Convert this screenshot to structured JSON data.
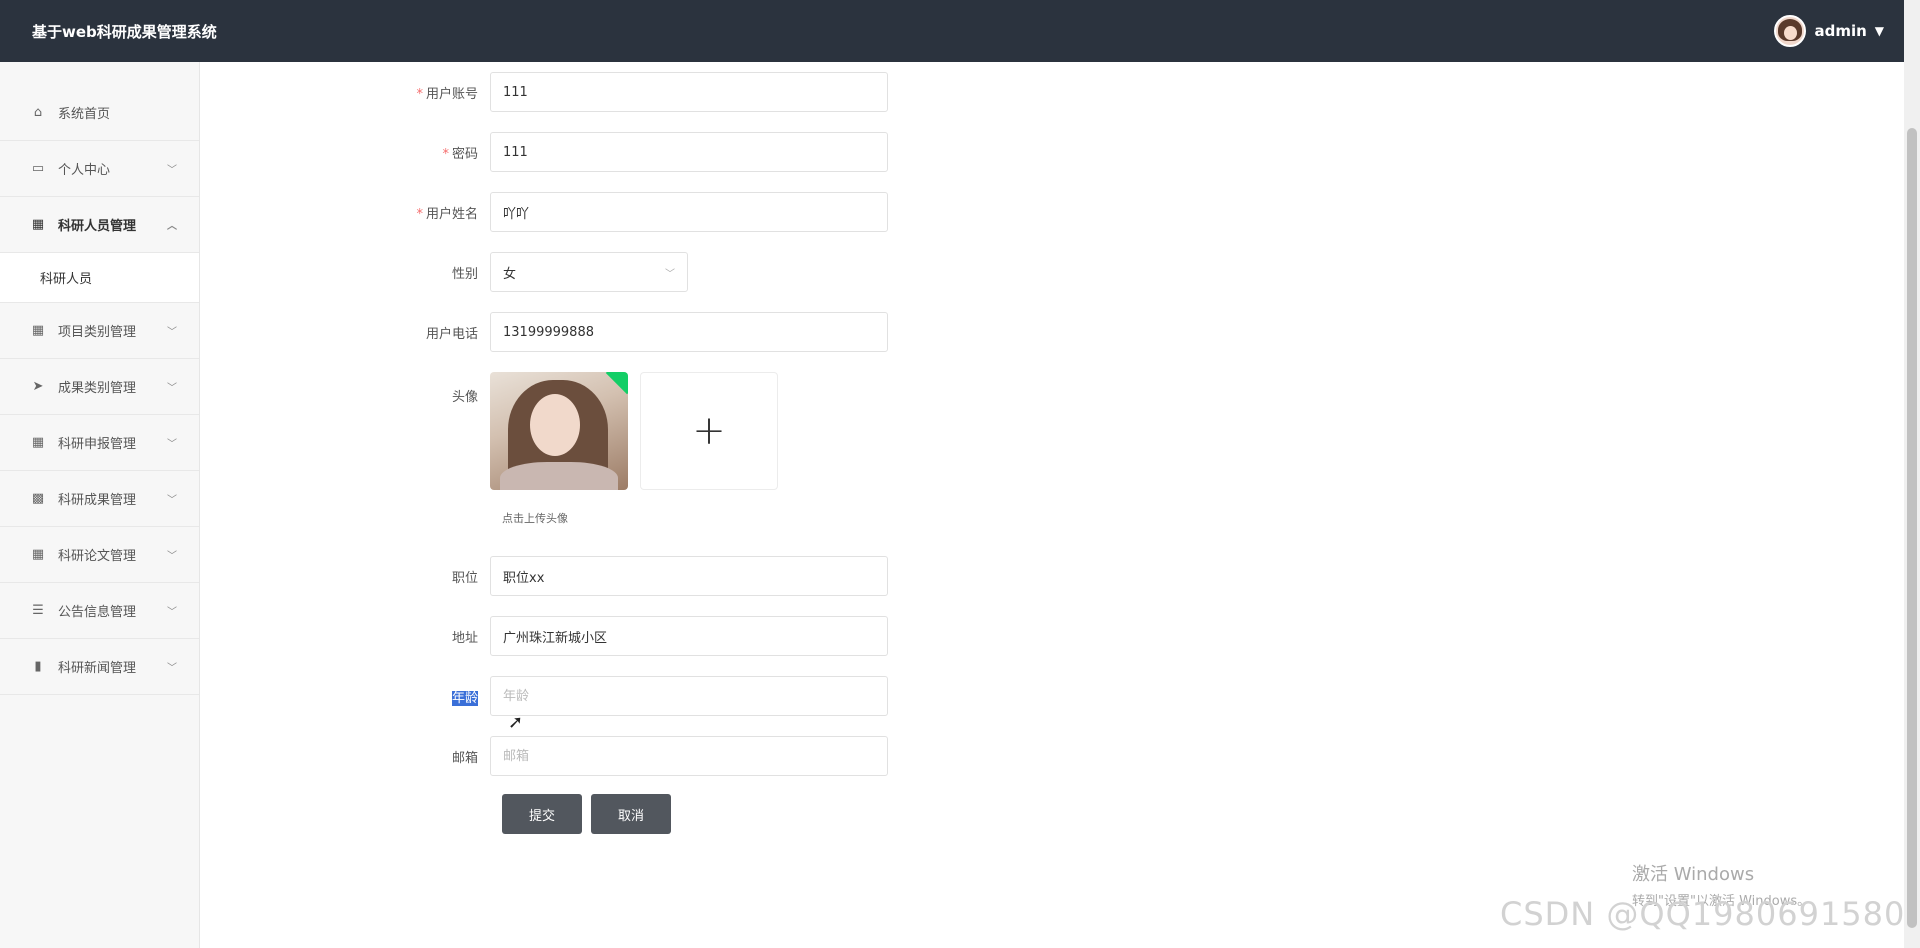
{
  "header": {
    "app_title": "基于web科研成果管理系统",
    "username": "admin"
  },
  "sidebar": {
    "items": [
      {
        "label": "系统首页",
        "icon": "home-icon"
      },
      {
        "label": "个人中心",
        "icon": "card-icon"
      },
      {
        "label": "科研人员管理",
        "icon": "grid-icon"
      },
      {
        "label": "科研人员"
      },
      {
        "label": "项目类别管理",
        "icon": "grid-icon"
      },
      {
        "label": "成果类别管理",
        "icon": "send-icon"
      },
      {
        "label": "科研申报管理",
        "icon": "grid-icon"
      },
      {
        "label": "科研成果管理",
        "icon": "apps-icon"
      },
      {
        "label": "科研论文管理",
        "icon": "grid-icon"
      },
      {
        "label": "公告信息管理",
        "icon": "sliders-icon"
      },
      {
        "label": "科研新闻管理",
        "icon": "bar-chart-icon"
      }
    ]
  },
  "form": {
    "account": {
      "label": "用户账号",
      "value": "111"
    },
    "password": {
      "label": "密码",
      "value": "111"
    },
    "name": {
      "label": "用户姓名",
      "value": "吖吖"
    },
    "gender": {
      "label": "性别",
      "value": "女"
    },
    "phone": {
      "label": "用户电话",
      "value": "13199999888"
    },
    "avatar": {
      "label": "头像",
      "hint": "点击上传头像"
    },
    "position": {
      "label": "职位",
      "value": "职位xx"
    },
    "address": {
      "label": "地址",
      "value": "广州珠江新城小区"
    },
    "age": {
      "label": "年龄",
      "placeholder": "年龄"
    },
    "email": {
      "label": "邮箱",
      "placeholder": "邮箱"
    },
    "required_mark": "*",
    "submit_label": "提交",
    "cancel_label": "取消",
    "upload_plus": "+"
  },
  "watermarks": {
    "windows_line1": "激活 Windows",
    "windows_line2": "转到\"设置\"以激活 Windows。",
    "csdn": "CSDN @QQ1980691580"
  },
  "colors": {
    "header_bg": "#2b333e",
    "button_bg": "#52575e",
    "required": "#f56c6c"
  }
}
